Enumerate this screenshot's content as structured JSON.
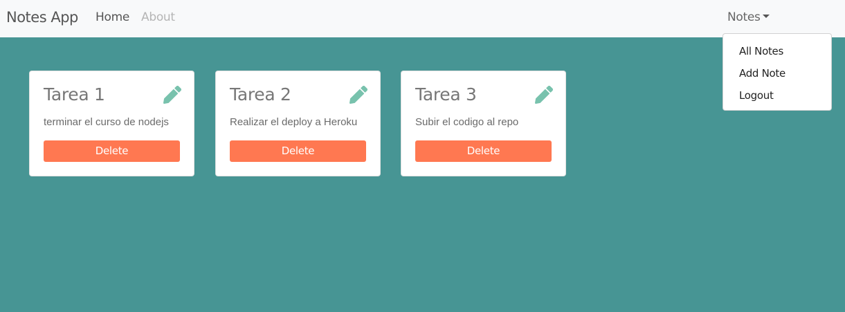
{
  "navbar": {
    "brand": "Notes App",
    "links": [
      "Home",
      "About"
    ],
    "dropdown_label": "Notes"
  },
  "dropdown": {
    "items": [
      "All Notes",
      "Add Note",
      "Logout"
    ]
  },
  "notes": [
    {
      "title": "Tarea 1",
      "description": "terminar el curso de nodejs",
      "delete_label": "Delete"
    },
    {
      "title": "Tarea 2",
      "description": "Realizar el deploy a Heroku",
      "delete_label": "Delete"
    },
    {
      "title": "Tarea 3",
      "description": "Subir el codigo al repo",
      "delete_label": "Delete"
    }
  ],
  "icons": {
    "edit": "pencil-icon",
    "dropdown_caret": "caret-down-icon"
  },
  "colors": {
    "background": "#479594",
    "navbar": "#f8f9fa",
    "delete_button": "#ff7851",
    "edit_icon": "#78c2ad"
  }
}
